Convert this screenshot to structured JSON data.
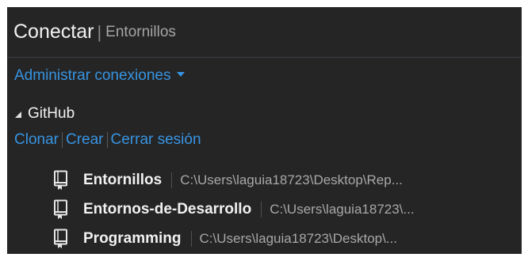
{
  "header": {
    "title": "Conectar",
    "separator": "|",
    "subtitle": "Entornillos"
  },
  "manage_connections": {
    "label": "Administrar conexiones"
  },
  "section": {
    "title": "GitHub"
  },
  "actions": [
    {
      "label": "Clonar"
    },
    {
      "label": "Crear"
    },
    {
      "label": "Cerrar sesión"
    }
  ],
  "repositories": [
    {
      "name": "Entornillos",
      "path": "C:\\Users\\laguia18723\\Desktop\\Rep..."
    },
    {
      "name": "Entornos-de-Desarrollo",
      "path": "C:\\Users\\laguia18723\\..."
    },
    {
      "name": "Programming",
      "path": "C:\\Users\\laguia18723\\Desktop\\..."
    }
  ],
  "icons": {
    "repo": "repository-icon",
    "expander": "expander-triangle-icon",
    "dropdown": "chevron-down-icon"
  },
  "colors": {
    "background": "#252526",
    "text": "#f1f1f1",
    "link": "#3794e1",
    "muted": "#a8a8a8"
  }
}
